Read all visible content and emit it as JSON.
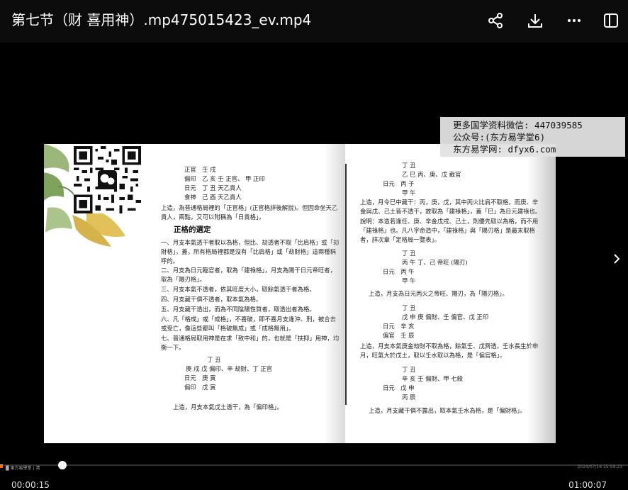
{
  "window": {
    "title": "第七节（财 喜用神）.mp475015423_ev.mp4",
    "share_icon": "share-icon",
    "download_icon": "download-icon",
    "more_icon": "more-icon",
    "sidebar_icon": "panel-icon"
  },
  "watermark": {
    "line1": "更多国学资料微信: 447039585",
    "line2": "公众号:(东方易学堂6)",
    "line3": "东方易学网: dfyx6.com"
  },
  "document": {
    "left": {
      "chart1": [
        "正官　壬 戌",
        "偏印　乙 亥 壬 正官、 甲 正印",
        "日元　丁 丑 天乙貴人",
        "食神　己 酉 天乙貴人"
      ],
      "note1": "上造，為普通格局裡的「正官格」(正官格詳後解說)。但因命坐天乙貴人，兩點，又可以附稱為「日貴格」。",
      "heading": "正格的選定",
      "rules": [
        "一、月支本氣透干者取以為格，但比、劫透者不取「比肩格」或「劫財格」，蓋，所有格局裡都是沒有「比肩格」或「劫財格」這兩種稱呼的。",
        "二、月支為日元臨官者，取為「建祿格」，月支為陽干日元帝旺者，取為「陽刃格」。",
        "三、月支本氣不透者，依其旺度大小，取餘氣透干者為格。",
        "四、月支藏干俱不透者，取本氣為格。",
        "五、月支藏干透出，而為不同陰陽性質者，取透出者為格。",
        "六、凡「格成」或「成格」，不喜破，即不喜月支逢沖、刑，被合去或受亡，像這些都叫「格破無成」或「成格無用」。",
        "七、普通格局取用神是在求「致中和」的，也就是「扶抑」用神，均衡一下。"
      ],
      "chart2": [
        "丁 丑",
        "庚 戌 戊 偏印、辛 劫財、丁 正官",
        "日元　庚 寅",
        "偏印　戊 寅"
      ],
      "note2": "上造，月支本氣戊土透干，為「偏印格」。"
    },
    "right": {
      "chart1": [
        "丁 丑",
        "乙 巳 丙、庚、戊 截官",
        "日元　丙 子",
        "甲 午"
      ],
      "note1": "上造，月令巳中藏干：丙，庚，戊，其中丙火比肩不取格，而庚、辛金與戊、己土皆不透干，故取為「建祿格」，蓋「巳」為日元建祿也。",
      "note2": "說明：本造若逢任、庚、辛金戊戌、己土，則優先取以為格，而不用「建祿格」也。凡八字命造中，「建祿格」與「陽刃格」是最末取格者，詳次章「定格局一覽表」。",
      "chart2": [
        "丁 丑",
        "丙 午 丁、己 帝旺 (陽刃)",
        "日元　丙 午",
        "甲 午"
      ],
      "note3": "上造，月支為日元丙火之帝旺、陽刃，為「陽刃格」。",
      "chart3": [
        "丁 丑",
        "戊 申 庚 偏財、壬 偏官、戊 正印",
        "日元　辛 亥",
        "偏官　壬 辰"
      ],
      "note4": "上造，月支本氣庚金劫財不取為格，餘氣壬、戊齊透，壬水長生於申月，旺氣大於戊土，取以壬水取以為格，是「偏官格」。",
      "chart4": [
        "丁 丑",
        "辛 亥 壬 偏財、甲 七殺",
        "日元　戊 申",
        "丙 辰"
      ],
      "note5": "上造，月支藏干俱不露出，取本氣壬水為格，是「偏財格」。"
    }
  },
  "player": {
    "current_time": "00:00:15",
    "duration": "01:00:07",
    "progress": 0.004,
    "info_text": "█ 東方易學堂 | 清",
    "timestamp": "2024/07/16 15:59:23",
    "next_icon": "chevron-right-icon"
  }
}
